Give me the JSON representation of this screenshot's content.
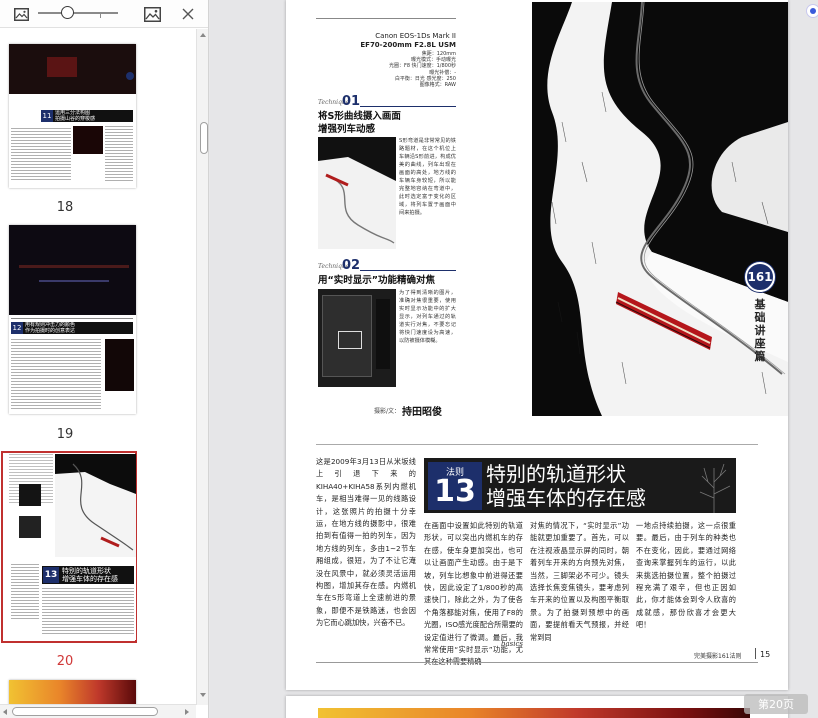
{
  "sidebar": {
    "thumbnails": [
      {
        "label": "18",
        "heading_num": "11",
        "heading_line1": "运用三分法构图",
        "heading_line2": "拍摄山谷的穿梭感"
      },
      {
        "label": "19",
        "heading_num": "12",
        "heading_line1": "用有规则冲击力的颜色",
        "heading_line2": "作为拍摄时的创意表达"
      },
      {
        "label": "20",
        "heading_num": "13",
        "heading_line1": "特别的轨道形状",
        "heading_line2": "增强车体的存在感"
      }
    ],
    "zoom_level": 0.35
  },
  "article": {
    "exif": {
      "camera": "Canon EOS-1Ds Mark II",
      "lens": "EF70-200mm F2.8L USM",
      "lines": [
        "焦距：120mm",
        "曝光模式：手动曝光",
        "光圈：F8  快门速度：1/800秒",
        "曝光补偿：-",
        "白平衡：日光  感光度：250",
        "图像格式：RAW"
      ]
    },
    "tech1": {
      "kicker": "Technique",
      "num": "01",
      "title_line1": "将S形曲线摄入画面",
      "title_line2": "增强列车动感",
      "body": "S形弯道是非常常见的铁路题材，在这个机位上车辆沿S形前进，构成优美的曲线，列车出现在画面的高处，地方线的车辆车身较短，所以能完整地容纳在弯道中，此时选定富于变化的区域，将列车置于画面中间来拍摄。"
    },
    "tech2": {
      "kicker": "Technique",
      "num": "02",
      "title": "用“实时显示”功能精确对焦",
      "body": "为了得到清晰的图片，准确对焦很重要，使用实时显示功能中的扩大显示，对列车通过的轨道实行对焦，不要忘记将快门速度设为高速，以防被摄体模糊。"
    },
    "photographer_prefix": "摄影/文：",
    "photographer": "持田昭俊",
    "side_badge": "161",
    "side_title": "基础讲座篇",
    "banner": {
      "fati": "法则",
      "num": "13",
      "line1": "特别的轨道形状",
      "line2": "增强车体的存在感"
    },
    "intro": "这是2009年3月13日从米坂线上引退下来的KIHA40+KIHA58系列内燃机车，是相当难得一见的线路设计，这张照片的拍摄十分幸运，在地方线的摄影中，很难拍到有值得一拍的列车，因为地方线的列车，多由1~2节车厢组成，很短，为了不让它淹没在风景中，就必须灵活运用构图，增加其存在感。内燃机车在S形弯道上全速前进的景象，即便不是铁路迷，也会因为它而心跳加快，兴奋不已。",
    "col1": "在画面中设置如此特别的轨道形状，可以突出内燃机车的存在感，使车身更加突出，也可以让画面产生动感。由于是下坡，列车比想象中前进得还要快，因此设定了1/800秒的高速快门，除此之外，为了使各个角落都能对焦，使用了F8的光圈，ISO感光度配合所需要的设定值进行了微调。最后，我常常使用“实时显示”功能，尤其在这种需要精确",
    "col2": "对焦的情况下，“实时显示”功能就更加重要了。首先，可以在注视液晶显示屏的同时，朝着列车开来的方向预先对焦，当然，三脚架必不可少。镜头选择长焦变焦镜头，要考虑列车开来的位置以及构图平衡取景。为了拍摄到预想中的画面，要提前看天气预报，并经常到同",
    "col3": "一地点持续拍摄，这一点很重要。最后，由于列车的种类也不在变化，因此，要通过网络查询来掌握列车的运行，以此来挑选拍摄位置，整个拍摄过程充满了艰辛，但也正因如此，你才能体会到令人欣喜的成就感，那份欣喜才会更大吧！",
    "footer_basics": "basics",
    "footer_mag": "完美摄影161法则",
    "footer_page": "15"
  },
  "viewer": {
    "page_indicator": "第20页"
  },
  "colors": {
    "accent_navy": "#1d2f6b",
    "active_red": "#d03838"
  }
}
